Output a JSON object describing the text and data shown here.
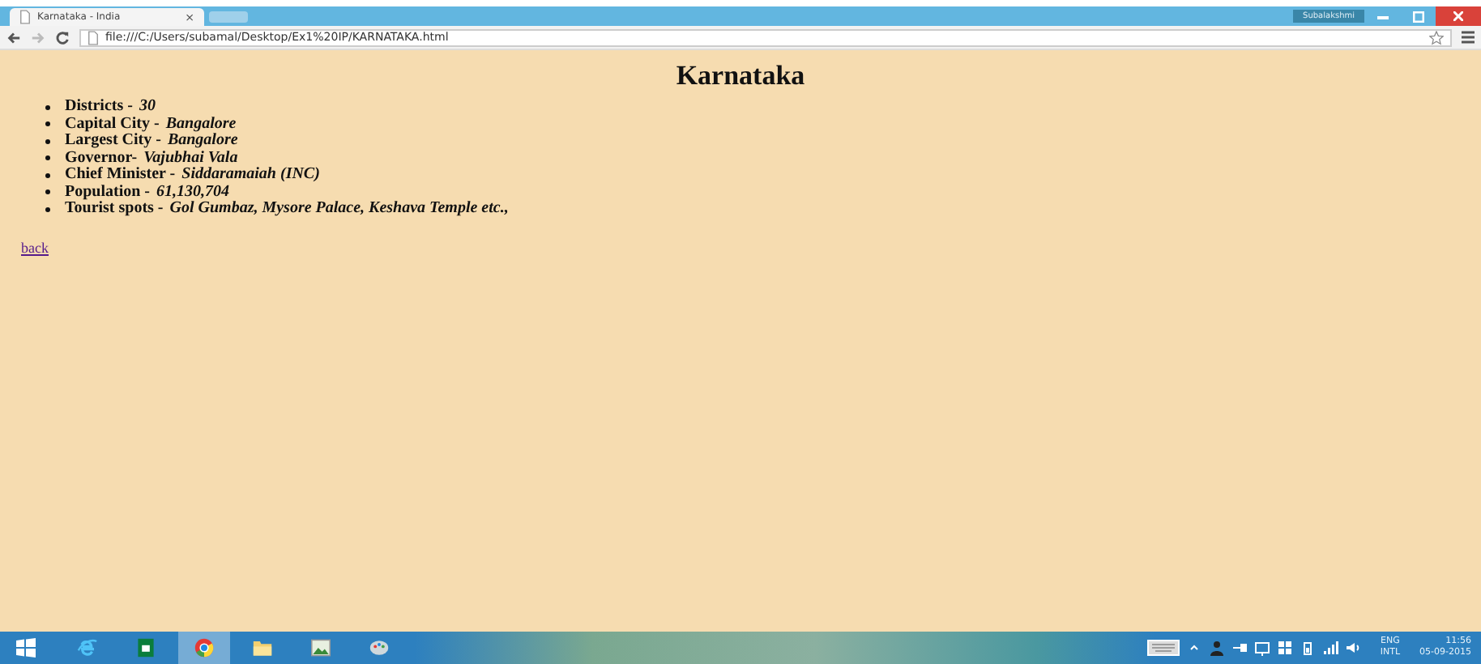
{
  "browser": {
    "tab_title": "Karnataka - India",
    "tab_close": "×",
    "user": "Subalakshmi",
    "address": "file:///C:/Users/subamal/Desktop/Ex1%20IP/KARNATAKA.html"
  },
  "page": {
    "heading": "Karnataka",
    "facts": [
      {
        "label": "Districts -",
        "value": "30"
      },
      {
        "label": "Capital City -",
        "value": "Bangalore"
      },
      {
        "label": "Largest City -",
        "value": "Bangalore"
      },
      {
        "label": "Governor-",
        "value": "Vajubhai Vala"
      },
      {
        "label": "Chief Minister -",
        "value": "Siddaramaiah (INC)"
      },
      {
        "label": "Population -",
        "value": "61,130,704"
      },
      {
        "label": "Tourist spots -",
        "value": "Gol Gumbaz, Mysore Palace, Keshava Temple etc.,"
      }
    ],
    "link": "back"
  },
  "taskbar": {
    "apps": [
      {
        "kind": "ie",
        "selected": false
      },
      {
        "kind": "store",
        "selected": false
      },
      {
        "kind": "chrome",
        "selected": true
      },
      {
        "kind": "folder",
        "selected": false
      },
      {
        "kind": "image",
        "selected": false
      },
      {
        "kind": "paint",
        "selected": false
      }
    ],
    "language": "ENG",
    "layout": "INTL",
    "time": "11:56",
    "date": "05-09-2015"
  }
}
